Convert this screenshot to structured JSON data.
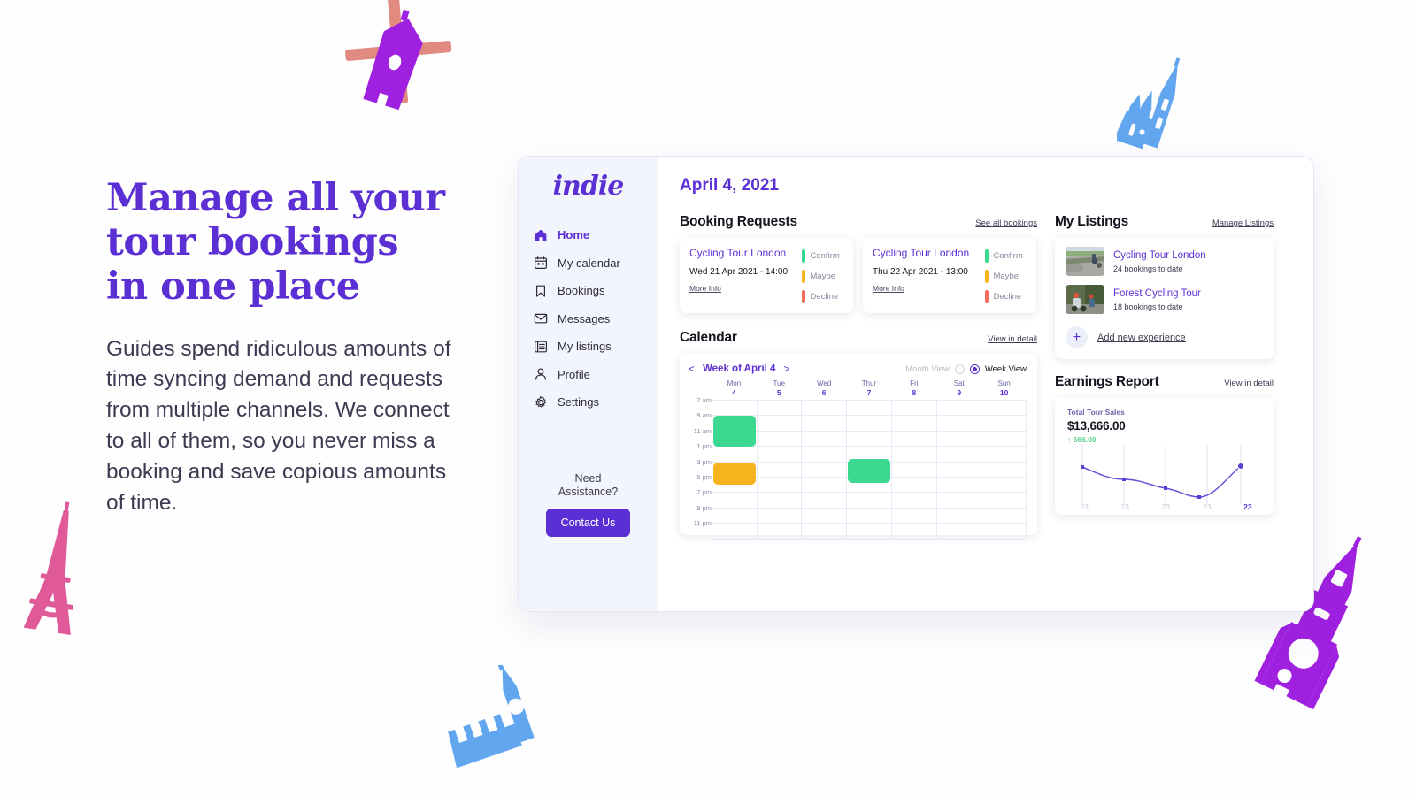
{
  "hero": {
    "title_lines": [
      "Manage all your",
      "tour bookings",
      "in one place"
    ],
    "body": "Guides spend ridiculous amounts of time syncing demand and requests from multiple channels. We connect to all of them, so you never miss a booking and save copious amounts of time.",
    "title_color": "#5b2fd4"
  },
  "sidebar": {
    "logo": "indie",
    "items": [
      {
        "label": "Home",
        "icon": "home-icon",
        "active": true
      },
      {
        "label": "My calendar",
        "icon": "calendar-icon",
        "active": false
      },
      {
        "label": "Bookings",
        "icon": "bookmark-icon",
        "active": false
      },
      {
        "label": "Messages",
        "icon": "envelope-icon",
        "active": false
      },
      {
        "label": "My listings",
        "icon": "list-icon",
        "active": false
      },
      {
        "label": "Profile",
        "icon": "user-icon",
        "active": false
      },
      {
        "label": "Settings",
        "icon": "gear-icon",
        "active": false
      }
    ],
    "assist_line1": "Need",
    "assist_line2": "Assistance?",
    "contact_label": "Contact Us"
  },
  "main": {
    "date_title": "April 4, 2021",
    "booking_requests": {
      "title": "Booking Requests",
      "see_all_label": "See all bookings",
      "actions": [
        {
          "label": "Confirm",
          "color": "#3bd98f"
        },
        {
          "label": "Maybe",
          "color": "#f5b41d"
        },
        {
          "label": "Decline",
          "color": "#f76b5b"
        }
      ],
      "cards": [
        {
          "name": "Cycling Tour London",
          "when": "Wed 21 Apr 2021 - 14:00",
          "more_label": "More Info"
        },
        {
          "name": "Cycling Tour London",
          "when": "Thu 22 Apr 2021 - 13:00",
          "more_label": "More Info"
        }
      ]
    },
    "calendar": {
      "title": "Calendar",
      "view_link": "View in detail",
      "week_label": "Week of April 4",
      "prev_arrow": "<",
      "next_arrow": ">",
      "month_view_label": "Month View",
      "week_view_label": "Week View",
      "selected_view": "Week View",
      "days": [
        {
          "dow": "Mon",
          "num": "4"
        },
        {
          "dow": "Tue",
          "num": "5"
        },
        {
          "dow": "Wed",
          "num": "6"
        },
        {
          "dow": "Thur",
          "num": "7"
        },
        {
          "dow": "Fri",
          "num": "8"
        },
        {
          "dow": "Sat",
          "num": "9"
        },
        {
          "dow": "Sun",
          "num": "10"
        }
      ],
      "times": [
        "7 am",
        "9 am",
        "11 am",
        "1 pm",
        "3 pm",
        "5 pm",
        "7 pm",
        "9 pm",
        "11 pm"
      ],
      "events": [
        {
          "day": 0,
          "start_row": 1,
          "span_rows": 2,
          "color": "#3bd98f"
        },
        {
          "day": 0,
          "start_row": 4,
          "span_rows": 1.4,
          "color": "#f5b41d"
        },
        {
          "day": 3,
          "start_row": 3.8,
          "span_rows": 1.5,
          "color": "#3bd98f"
        }
      ]
    },
    "listings": {
      "title": "My Listings",
      "manage_label": "Manage Listings",
      "items": [
        {
          "name": "Cycling Tour London",
          "sub": "24 bookings to date",
          "thumb": "road-cyclists-photo"
        },
        {
          "name": "Forest Cycling Tour",
          "sub": "18 bookings to date",
          "thumb": "forest-cyclist-photo"
        }
      ],
      "add_label": "Add new experience",
      "add_icon": "plus-icon"
    },
    "earnings": {
      "title": "Earnings Report",
      "view_link": "View in detail",
      "metric_label": "Total Tour Sales",
      "metric_value": "$13,666.00",
      "delta": "↑ 666.00",
      "delta_color": "#5ad08e"
    }
  },
  "chart_data": {
    "type": "line",
    "title": "Total Tour Sales",
    "x": [
      1,
      2,
      3,
      4,
      5
    ],
    "tick_labels": [
      "23",
      "23",
      "23",
      "23",
      "23"
    ],
    "highlighted_tick_index": 4,
    "values": [
      72,
      56,
      40,
      26,
      74
    ],
    "ylim": [
      0,
      100
    ],
    "line_color": "#6b4fd8",
    "grid": "vertical-ticks",
    "legend": "none",
    "xlabel": "",
    "ylabel": ""
  },
  "decorations": [
    {
      "name": "windmill",
      "colors": [
        "#a020e0",
        "#e08a80"
      ]
    },
    {
      "name": "cathedral",
      "colors": [
        "#62a6f0"
      ]
    },
    {
      "name": "eiffel-tower",
      "colors": [
        "#e05a9a"
      ]
    },
    {
      "name": "big-ben",
      "colors": [
        "#62a6f0"
      ]
    },
    {
      "name": "clock-tower",
      "colors": [
        "#a020e0"
      ]
    }
  ]
}
